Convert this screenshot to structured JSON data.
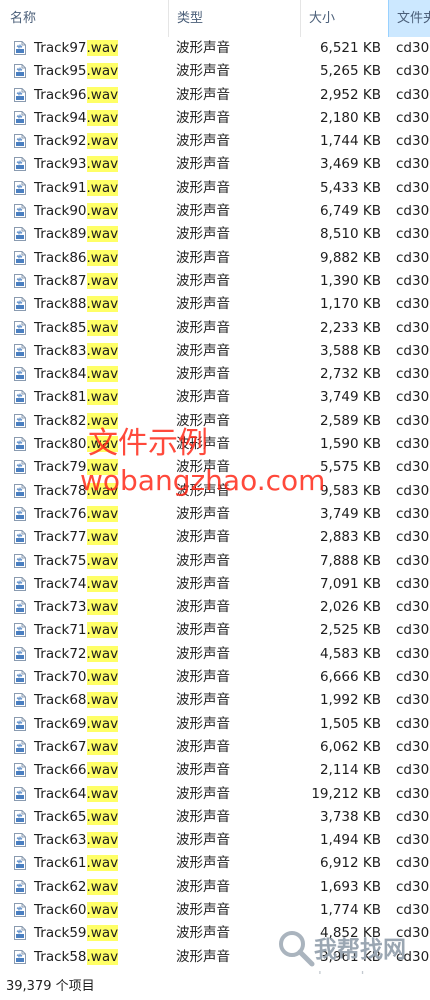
{
  "header": {
    "name_label": "名称",
    "type_label": "类型",
    "size_label": "大小",
    "folder_label": "文件夹"
  },
  "files": [
    {
      "base": "Track97",
      "ext": ".wav",
      "type": "波形声音",
      "size": "6,521 KB",
      "folder": "cd30"
    },
    {
      "base": "Track95",
      "ext": ".wav",
      "type": "波形声音",
      "size": "5,265 KB",
      "folder": "cd30"
    },
    {
      "base": "Track96",
      "ext": ".wav",
      "type": "波形声音",
      "size": "2,952 KB",
      "folder": "cd30"
    },
    {
      "base": "Track94",
      "ext": ".wav",
      "type": "波形声音",
      "size": "2,180 KB",
      "folder": "cd30"
    },
    {
      "base": "Track92",
      "ext": ".wav",
      "type": "波形声音",
      "size": "1,744 KB",
      "folder": "cd30"
    },
    {
      "base": "Track93",
      "ext": ".wav",
      "type": "波形声音",
      "size": "3,469 KB",
      "folder": "cd30"
    },
    {
      "base": "Track91",
      "ext": ".wav",
      "type": "波形声音",
      "size": "5,433 KB",
      "folder": "cd30"
    },
    {
      "base": "Track90",
      "ext": ".wav",
      "type": "波形声音",
      "size": "6,749 KB",
      "folder": "cd30"
    },
    {
      "base": "Track89",
      "ext": ".wav",
      "type": "波形声音",
      "size": "8,510 KB",
      "folder": "cd30"
    },
    {
      "base": "Track86",
      "ext": ".wav",
      "type": "波形声音",
      "size": "9,882 KB",
      "folder": "cd30"
    },
    {
      "base": "Track87",
      "ext": ".wav",
      "type": "波形声音",
      "size": "1,390 KB",
      "folder": "cd30"
    },
    {
      "base": "Track88",
      "ext": ".wav",
      "type": "波形声音",
      "size": "1,170 KB",
      "folder": "cd30"
    },
    {
      "base": "Track85",
      "ext": ".wav",
      "type": "波形声音",
      "size": "2,233 KB",
      "folder": "cd30"
    },
    {
      "base": "Track83",
      "ext": ".wav",
      "type": "波形声音",
      "size": "3,588 KB",
      "folder": "cd30"
    },
    {
      "base": "Track84",
      "ext": ".wav",
      "type": "波形声音",
      "size": "2,732 KB",
      "folder": "cd30"
    },
    {
      "base": "Track81",
      "ext": ".wav",
      "type": "波形声音",
      "size": "3,749 KB",
      "folder": "cd30"
    },
    {
      "base": "Track82",
      "ext": ".wav",
      "type": "波形声音",
      "size": "2,589 KB",
      "folder": "cd30"
    },
    {
      "base": "Track80",
      "ext": ".wav",
      "type": "波形声音",
      "size": "1,590 KB",
      "folder": "cd30"
    },
    {
      "base": "Track79",
      "ext": ".wav",
      "type": "波形声音",
      "size": "5,575 KB",
      "folder": "cd30"
    },
    {
      "base": "Track78",
      "ext": ".wav",
      "type": "波形声音",
      "size": "9,583 KB",
      "folder": "cd30"
    },
    {
      "base": "Track76",
      "ext": ".wav",
      "type": "波形声音",
      "size": "3,749 KB",
      "folder": "cd30"
    },
    {
      "base": "Track77",
      "ext": ".wav",
      "type": "波形声音",
      "size": "2,883 KB",
      "folder": "cd30"
    },
    {
      "base": "Track75",
      "ext": ".wav",
      "type": "波形声音",
      "size": "7,888 KB",
      "folder": "cd30"
    },
    {
      "base": "Track74",
      "ext": ".wav",
      "type": "波形声音",
      "size": "7,091 KB",
      "folder": "cd30"
    },
    {
      "base": "Track73",
      "ext": ".wav",
      "type": "波形声音",
      "size": "2,026 KB",
      "folder": "cd30"
    },
    {
      "base": "Track71",
      "ext": ".wav",
      "type": "波形声音",
      "size": "2,525 KB",
      "folder": "cd30"
    },
    {
      "base": "Track72",
      "ext": ".wav",
      "type": "波形声音",
      "size": "4,583 KB",
      "folder": "cd30"
    },
    {
      "base": "Track70",
      "ext": ".wav",
      "type": "波形声音",
      "size": "6,666 KB",
      "folder": "cd30"
    },
    {
      "base": "Track68",
      "ext": ".wav",
      "type": "波形声音",
      "size": "1,992 KB",
      "folder": "cd30"
    },
    {
      "base": "Track69",
      "ext": ".wav",
      "type": "波形声音",
      "size": "1,505 KB",
      "folder": "cd30"
    },
    {
      "base": "Track67",
      "ext": ".wav",
      "type": "波形声音",
      "size": "6,062 KB",
      "folder": "cd30"
    },
    {
      "base": "Track66",
      "ext": ".wav",
      "type": "波形声音",
      "size": "2,114 KB",
      "folder": "cd30"
    },
    {
      "base": "Track64",
      "ext": ".wav",
      "type": "波形声音",
      "size": "19,212 KB",
      "folder": "cd30"
    },
    {
      "base": "Track65",
      "ext": ".wav",
      "type": "波形声音",
      "size": "3,738 KB",
      "folder": "cd30"
    },
    {
      "base": "Track63",
      "ext": ".wav",
      "type": "波形声音",
      "size": "1,494 KB",
      "folder": "cd30"
    },
    {
      "base": "Track61",
      "ext": ".wav",
      "type": "波形声音",
      "size": "6,912 KB",
      "folder": "cd30"
    },
    {
      "base": "Track62",
      "ext": ".wav",
      "type": "波形声音",
      "size": "1,693 KB",
      "folder": "cd30"
    },
    {
      "base": "Track60",
      "ext": ".wav",
      "type": "波形声音",
      "size": "1,774 KB",
      "folder": "cd30"
    },
    {
      "base": "Track59",
      "ext": ".wav",
      "type": "波形声音",
      "size": "4,852 KB",
      "folder": "cd30"
    },
    {
      "base": "Track58",
      "ext": ".wav",
      "type": "波形声音",
      "size": "3,961 KB",
      "folder": "cd30"
    }
  ],
  "status": {
    "item_count": "39,379 个项目"
  },
  "watermark": {
    "line1": "文件示例",
    "line2": "wobangzhao.com",
    "corner_brand": "我帮找网",
    "corner_url": "wobangzhao.com"
  },
  "colors": {
    "extension_highlight": "#ffff66",
    "sorted_column_header": "#cce8ff",
    "watermark": "#ff2a1a",
    "header_text": "#4c607a"
  },
  "icons": {
    "file": "wav-file-icon",
    "corner_logo": "magnifier-icon"
  }
}
